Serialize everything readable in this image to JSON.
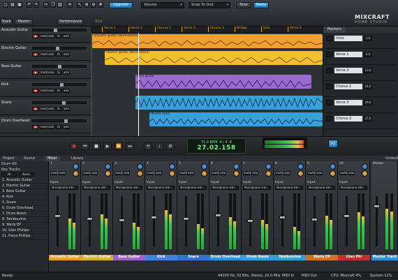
{
  "toolbar": {
    "track_label": "Track",
    "master_label": "Master",
    "performance_label": "Performance",
    "upgrade_label": "Upgrade",
    "volume_select": "Volume",
    "snap_select": "Snap To Grid",
    "tone_label": "Tone",
    "beats_label": "Beats",
    "position": "71.0"
  },
  "logo": {
    "line1": "MIXCRAFT",
    "line2": "HOME STUDIO"
  },
  "tracks": [
    {
      "name": "Acoustic Guitar"
    },
    {
      "name": "Electric Guitar"
    },
    {
      "name": "Bass Guitar"
    },
    {
      "name": "Kick"
    },
    {
      "name": "Snare"
    },
    {
      "name": "Drum Overhead"
    }
  ],
  "track_buttons": {
    "mute": "mute",
    "solo": "solo",
    "fx": "fx",
    "arm": "arm"
  },
  "ruler_markers": [
    "Verse 1",
    "Verse 2",
    "Chorus 1",
    "Verse 3",
    "Chorus 2",
    "Bridge",
    "Solo",
    "Verse 4"
  ],
  "clips": {
    "acoustic": "acoustic guitar (Normalized)",
    "electric": "electric guitar (Normalized)",
    "bass": "bass guitar",
    "drums": "drums room"
  },
  "markers_panel": {
    "tab": "Markers",
    "items": [
      {
        "name": "Intro",
        "value": "1.0"
      },
      {
        "name": "Verse 1",
        "value": "5.0"
      },
      {
        "name": "Verse 2",
        "value": "13.0"
      },
      {
        "name": "Chorus 1",
        "value": "21.0"
      },
      {
        "name": "Verse 3",
        "value": "29.0"
      },
      {
        "name": "Chorus 2",
        "value": "37.0"
      }
    ]
  },
  "lcd": {
    "tempo": "71.0 BPM",
    "signature": "4 / 4",
    "key": "E",
    "time": "27.02.158"
  },
  "fx_label": "FX",
  "lower_tabs": {
    "project": "Project",
    "sound": "Sound",
    "mixer": "Mixer",
    "library": "Library",
    "undock": "Undock"
  },
  "browser": {
    "header": "Drum Kit",
    "sub_header": "Key Tracks:",
    "all": "All",
    "none": "None",
    "items": [
      "1. Acoustic Guitar",
      "2. Electric Guitar",
      "3. Bass Guitar",
      "4. Kick",
      "5. Snare",
      "6. Drum Overhead",
      "7. Drum Room",
      "8. Tambourine",
      "9. Warly EP",
      "10. Glen Phillips",
      "11. Freya Phillips"
    ]
  },
  "mixer": {
    "input_label": "Input:",
    "input_value": "Microphone (HP...",
    "strips": [
      {
        "num": "1",
        "label": "Acoustic Guitar",
        "color": "#e8a020",
        "fader": 0.6,
        "meter": 0.55
      },
      {
        "num": "2",
        "label": "Electric Guitar",
        "color": "#d8b030",
        "fader": 0.55,
        "meter": 0.62
      },
      {
        "num": "3",
        "label": "Bass Guitar",
        "color": "#a060d0",
        "fader": 0.52,
        "meter": 0.48
      },
      {
        "num": "4",
        "label": "Kick",
        "color": "#4080e0",
        "fader": 0.58,
        "meter": 0.7
      },
      {
        "num": "5",
        "label": "Snare",
        "color": "#3070d0",
        "fader": 0.54,
        "meter": 0.45
      },
      {
        "num": "6",
        "label": "Drum Overhead",
        "color": "#3090e0",
        "fader": 0.62,
        "meter": 0.58
      },
      {
        "num": "7",
        "label": "Drum Room",
        "color": "#30a0e0",
        "fader": 0.5,
        "meter": 0.52
      },
      {
        "num": "8",
        "label": "Tambourine",
        "color": "#2f9fd8",
        "fader": 0.57,
        "meter": 0.4
      },
      {
        "num": "9",
        "label": "Warly EP",
        "color": "#d07020",
        "fader": 0.53,
        "meter": 0.6
      },
      {
        "num": "10",
        "label": "Glen Phi",
        "color": "#c03030",
        "fader": 0.6,
        "meter": 0.66
      }
    ],
    "master_label": "Master",
    "master_track": "Master Track",
    "master_level": 0.72
  },
  "status": {
    "ready": "Ready",
    "format": "44100 Hz, 32 Bits, Stereo, 20.0 Mils",
    "midi_in": "MIDI In",
    "midi_out": "MIDI Out",
    "cpu": "CPU: Mixcraft 4%",
    "system": "System 12%"
  },
  "colors": {
    "acoustic_clip": "#f0a030",
    "electric_clip": "#f0c030",
    "bass_clip": "#9a6ad0",
    "drum_clip": "#3aa0d8",
    "accent": "#2f8fd0"
  }
}
